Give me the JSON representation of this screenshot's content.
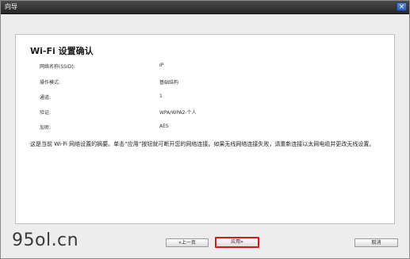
{
  "window": {
    "title": "向导",
    "close_glyph": "×"
  },
  "heading": "Wi-Fi 设置确认",
  "summary": [
    {
      "label": "网络名称(SSID):",
      "value": "IP"
    },
    {
      "label": "操作模式:",
      "value": "基础结构"
    },
    {
      "label": "通道:",
      "value": "1"
    },
    {
      "label": "验证:",
      "value": "WPA/WPA2-个人"
    },
    {
      "label": "加密:",
      "value": "AES"
    }
  ],
  "description": "这是当前 Wi-Fi 网络设置的摘要。单击“应用”按钮就可断开您的网络连接。如果无线网络连接失败，请重新连接以太网电缆并更改无线设置。",
  "watermark": "95ol.cn",
  "buttons": {
    "back": "«上一页",
    "apply": "应用»",
    "cancel": "取消"
  },
  "colors": {
    "highlight": "#d21a1a",
    "titlebar": "#2e2e2e"
  }
}
